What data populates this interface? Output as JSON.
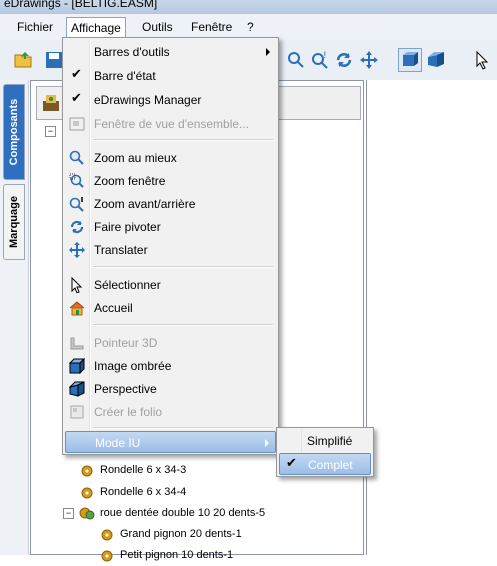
{
  "window": {
    "title": "eDrawings - [BELTIG.EASM]"
  },
  "menubar": {
    "items": [
      "Fichier",
      "Affichage",
      "Outils",
      "Fenêtre",
      "?"
    ]
  },
  "left_tabs": [
    "Composants",
    "Marquage"
  ],
  "menu": {
    "items": [
      {
        "label": "Barres d'outils",
        "icon": "submenu",
        "has_submenu": true
      },
      {
        "label": "Barre d'état",
        "icon": "check-icon",
        "checked": true
      },
      {
        "label": "eDrawings Manager",
        "icon": "check-icon",
        "checked": true
      },
      {
        "label": "Fenêtre de vue d'ensemble...",
        "icon": "overview-window-icon",
        "disabled": true
      },
      {
        "label": "Zoom au mieux",
        "icon": "zoom-fit-icon"
      },
      {
        "label": "Zoom fenêtre",
        "icon": "zoom-window-icon"
      },
      {
        "label": "Zoom avant/arrière",
        "icon": "zoom-in-out-icon"
      },
      {
        "label": "Faire pivoter",
        "icon": "rotate-icon"
      },
      {
        "label": "Translater",
        "icon": "pan-icon"
      },
      {
        "label": "Sélectionner",
        "icon": "select-cursor-icon"
      },
      {
        "label": "Accueil",
        "icon": "home-icon"
      },
      {
        "label": "Pointeur 3D",
        "icon": "pointer-3d-icon",
        "disabled": true
      },
      {
        "label": "Image ombrée",
        "icon": "shaded-icon"
      },
      {
        "label": "Perspective",
        "icon": "perspective-icon"
      },
      {
        "label": "Créer le folio",
        "icon": "create-sheet-icon",
        "disabled": true
      },
      {
        "label": "Mode IU",
        "icon": "submenu",
        "has_submenu": true,
        "highlighted": true
      }
    ]
  },
  "submenu": {
    "items": [
      {
        "label": "Simplifié",
        "checked": false
      },
      {
        "label": "Complet",
        "checked": true,
        "highlighted": true
      }
    ]
  },
  "tree": {
    "items": [
      {
        "label": "Rondelle 6 x 34-3"
      },
      {
        "label": "Rondelle 6 x 34-4"
      },
      {
        "label": "roue dentée double 10 20 dents-5"
      },
      {
        "label": "Grand pignon 20 dents-1"
      },
      {
        "label": "Petit pignon 10 dents-1"
      }
    ]
  },
  "colors": {
    "highlight": "#9dbde6",
    "gear_gold": "#d79b1c",
    "toolbar_blue": "#2a6fb8"
  }
}
